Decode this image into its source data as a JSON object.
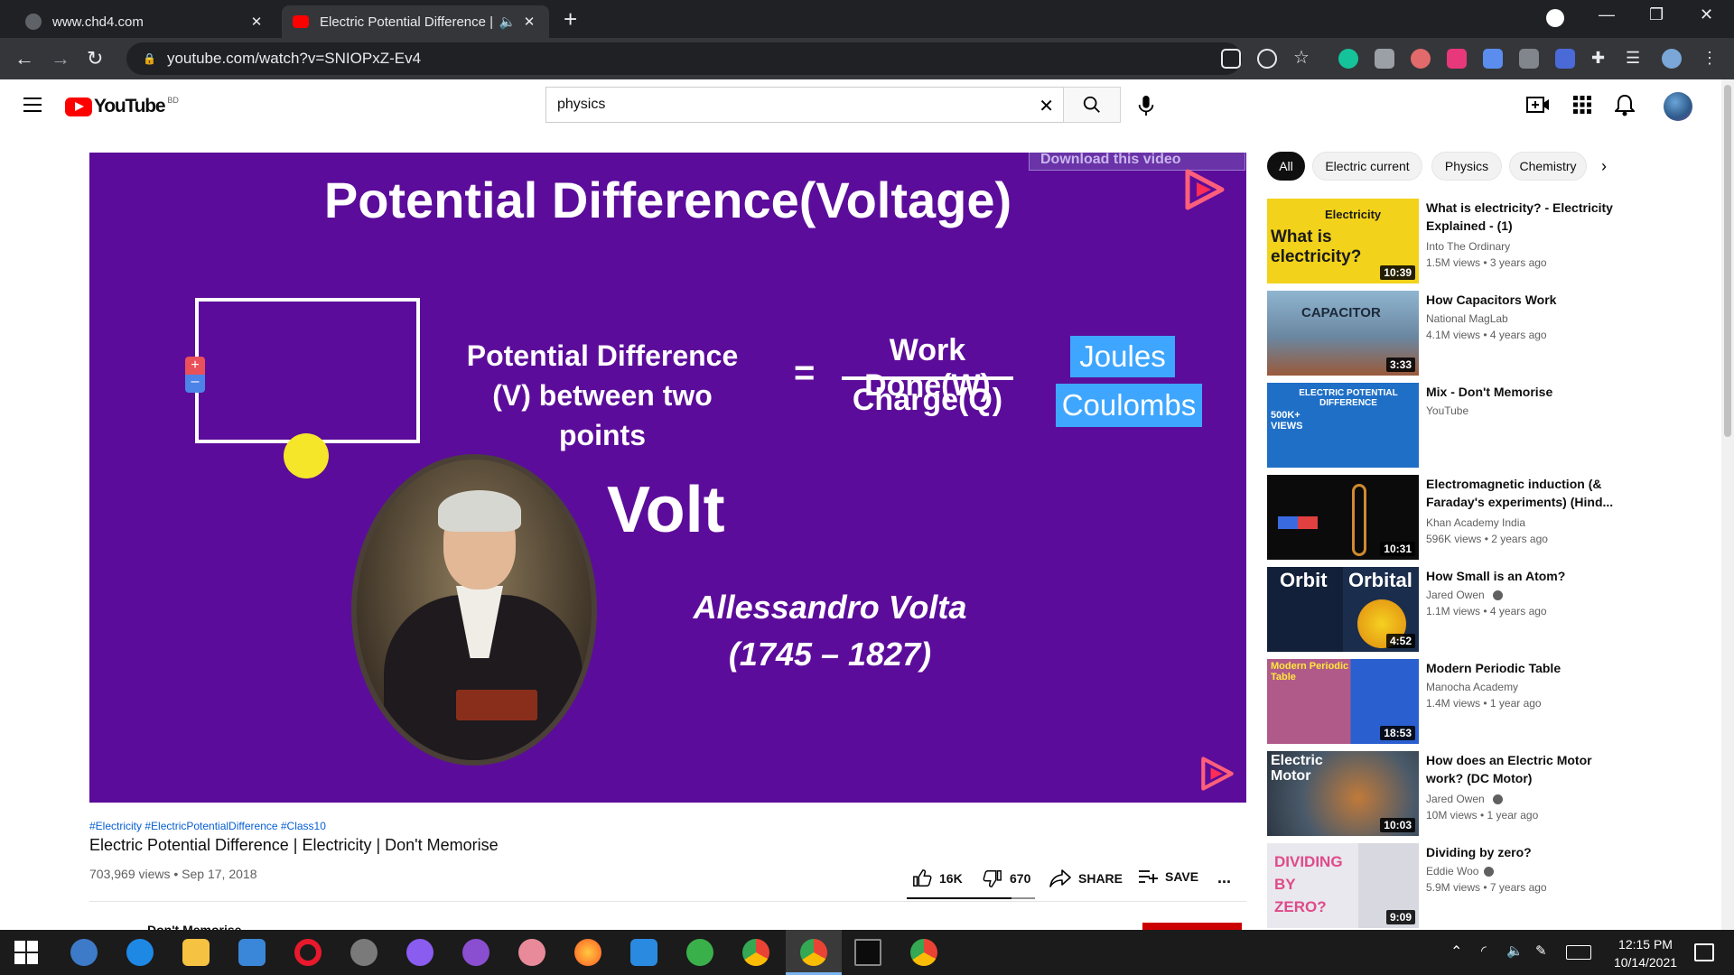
{
  "browser": {
    "tabs": [
      {
        "title": "www.chd4.com"
      },
      {
        "title": "Electric Potential Difference |"
      }
    ],
    "url": "youtube.com/watch?v=SNIOPxZ-Ev4"
  },
  "youtube": {
    "logo_text": "YouTube",
    "country_code": "BD",
    "search_value": "physics"
  },
  "video": {
    "download_overlay": "Download this video",
    "slide": {
      "title": "Potential Difference(Voltage)",
      "pd_line1": "Potential Difference",
      "pd_line2": "(V) between two points",
      "equals": "=",
      "numerator": "Work Done(W)",
      "denominator": "Charge(Q)",
      "unit_top": "Joules",
      "unit_bottom": "Coulombs",
      "unit_name": "Volt",
      "person_name": "Allessandro Volta",
      "person_years": "(1745 – 1827)",
      "battery_plus": "+",
      "battery_minus": "–"
    },
    "hashtags": "#Electricity #ElectricPotentialDifference #Class10",
    "title": "Electric Potential Difference | Electricity | Don't Memorise",
    "views_date": "703,969 views • Sep 17, 2018",
    "likes": "16K",
    "dislikes": "670",
    "like_ratio": 0.82,
    "share_label": "SHARE",
    "save_label": "SAVE",
    "more_label": "...",
    "channel": "Don't Memorise"
  },
  "chips": [
    "All",
    "Electric current",
    "Physics",
    "Chemistry"
  ],
  "recommendations": [
    {
      "title": "What is electricity? - Electricity Explained - (1)",
      "channel": "Into The Ordinary",
      "meta": "1.5M views • 3 years ago",
      "duration": "10:39",
      "thumb_text": "What is electricity?",
      "thumb_sub": "Electricity"
    },
    {
      "title": "How Capacitors Work",
      "channel": "National MagLab",
      "meta": "4.1M views • 4 years ago",
      "duration": "3:33",
      "thumb_text": "CAPACITOR"
    },
    {
      "title": "Mix - Don't Memorise",
      "channel": "YouTube",
      "meta": "",
      "duration": "",
      "thumb_text": "ELECTRIC POTENTIAL DIFFERENCE",
      "thumb_sub": "500K+ VIEWS"
    },
    {
      "title": "Electromagnetic induction (& Faraday's experiments) (Hind...",
      "channel": "Khan Academy India",
      "meta": "596K views • 2 years ago",
      "duration": "10:31"
    },
    {
      "title": "How Small is an Atom?",
      "channel": "Jared Owen",
      "meta": "1.1M views • 4 years ago",
      "duration": "4:52",
      "thumb_text": "Orbit",
      "thumb_sub": "Orbital"
    },
    {
      "title": "Modern Periodic Table",
      "channel": "Manocha Academy",
      "meta": "1.4M views • 1 year ago",
      "duration": "18:53",
      "thumb_text": "Modern Periodic Table"
    },
    {
      "title": "How does an Electric Motor work? (DC Motor)",
      "channel": "Jared Owen",
      "meta": "10M views • 1 year ago",
      "duration": "10:03",
      "thumb_text": "Electric Motor"
    },
    {
      "title": "Dividing by zero?",
      "channel": "Eddie Woo",
      "meta": "5.9M views • 7 years ago",
      "duration": "9:09",
      "thumb_text": "DIVIDING BY ZERO?"
    }
  ],
  "taskbar": {
    "time": "12:15 PM",
    "date": "10/14/2021"
  },
  "colors": {
    "slide_bg": "#5c0c9a",
    "youtube_red": "#ff0000",
    "unit_highlight": "#3ea6ff"
  },
  "icons": [
    "menu-icon",
    "youtube-logo-icon",
    "search-icon",
    "mic-icon",
    "create-icon",
    "apps-icon",
    "bell-icon",
    "like-icon",
    "dislike-icon",
    "share-icon",
    "save-icon",
    "verified-icon"
  ]
}
